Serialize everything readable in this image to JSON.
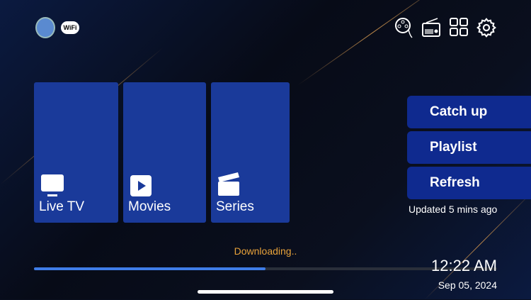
{
  "tiles": [
    {
      "label": "Live TV"
    },
    {
      "label": "Movies"
    },
    {
      "label": "Series"
    }
  ],
  "buttons": [
    {
      "label": "Catch up"
    },
    {
      "label": "Playlist"
    },
    {
      "label": "Refresh"
    }
  ],
  "updated": "Updated 5 mins ago",
  "status": "Downloading..",
  "progress": 0.5,
  "time": "12:22 AM",
  "date": "Sep 05, 2024",
  "wifi_label": "WiFi",
  "colors": {
    "tile": "#1a3a9a",
    "button": "#0f2a8f",
    "progress": "#3f7de8",
    "status": "#e8a23a"
  }
}
